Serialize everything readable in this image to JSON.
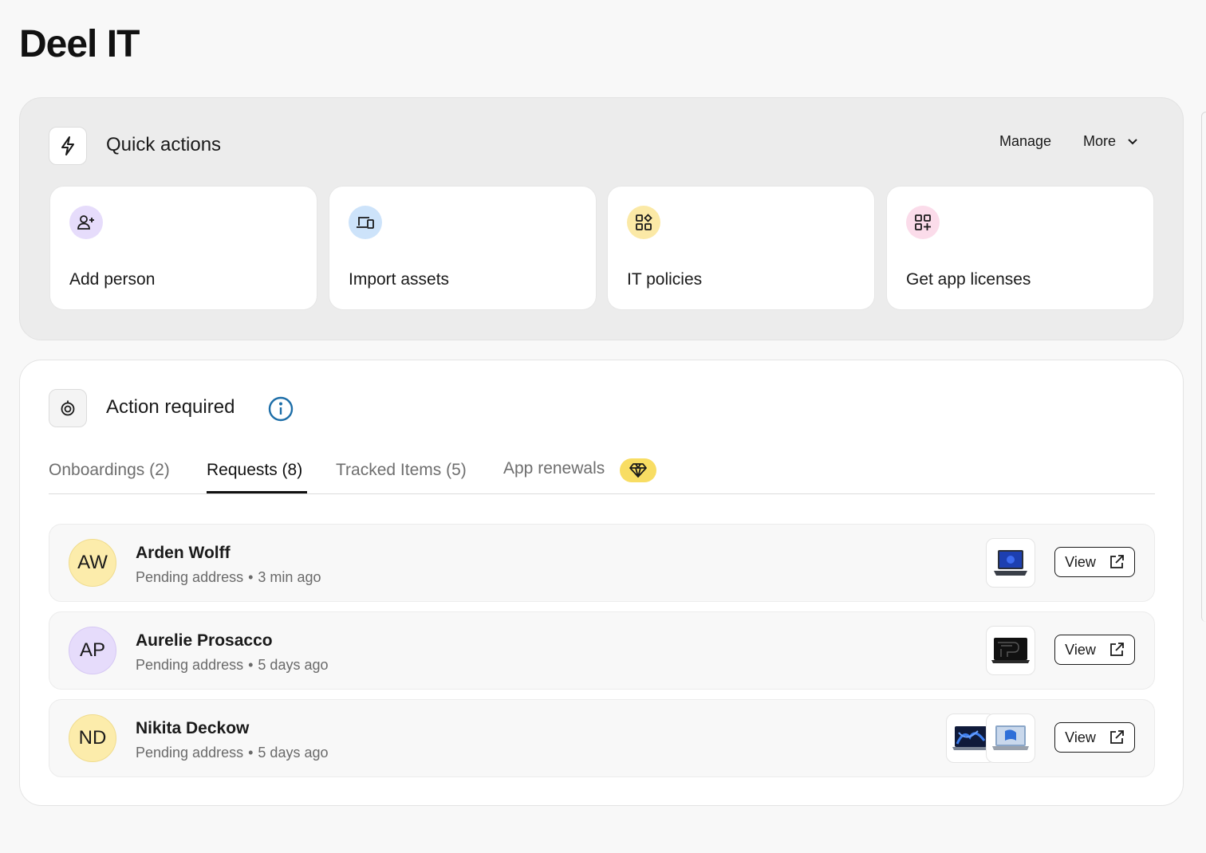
{
  "page": {
    "title": "Deel IT"
  },
  "quick_actions": {
    "title": "Quick actions",
    "icon": "lightning-icon",
    "manage_label": "Manage",
    "more_label": "More",
    "cards": [
      {
        "label": "Add person",
        "icon": "user-plus-icon",
        "color": "#e6dcfb"
      },
      {
        "label": "Import assets",
        "icon": "devices-icon",
        "color": "#cde3fa"
      },
      {
        "label": "IT policies",
        "icon": "apps-shapes-icon",
        "color": "#fbe9a6"
      },
      {
        "label": "Get app licenses",
        "icon": "grid-plus-icon",
        "color": "#fbdcea"
      }
    ]
  },
  "action_required": {
    "title": "Action required",
    "icon": "alarm-icon",
    "info_icon": "info-icon",
    "tabs": [
      {
        "label": "Onboardings (2)",
        "active": false
      },
      {
        "label": "Requests (8)",
        "active": true
      },
      {
        "label": "Tracked Items (5)",
        "active": false
      },
      {
        "label": "App renewals",
        "active": false,
        "badge_icon": "diamond-icon",
        "badge_color": "#f8dd63"
      }
    ],
    "requests": [
      {
        "initials": "AW",
        "name": "Arden Wolff",
        "status": "Pending address",
        "time": "3 min ago",
        "avatar_color": "#fcecab",
        "view_label": "View"
      },
      {
        "initials": "AP",
        "name": "Aurelie Prosacco",
        "status": "Pending address",
        "time": "5 days ago",
        "avatar_color": "#e6dcfb",
        "view_label": "View"
      },
      {
        "initials": "ND",
        "name": "Nikita Deckow",
        "status": "Pending address",
        "time": "5 days ago",
        "avatar_color": "#fcecab",
        "view_label": "View"
      }
    ]
  }
}
